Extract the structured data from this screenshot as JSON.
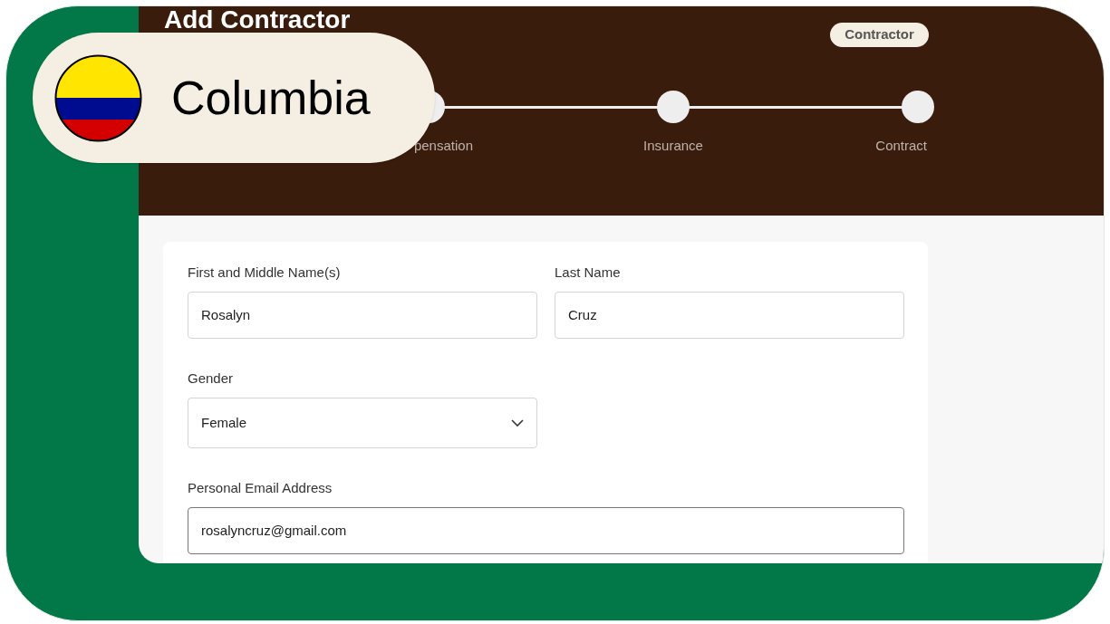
{
  "app": {
    "title": "Add Contractor",
    "badge": "Contractor"
  },
  "country_pill": {
    "label": "Columbia"
  },
  "stepper": {
    "steps": [
      {
        "label": "pensation"
      },
      {
        "label": "Insurance"
      },
      {
        "label": "Contract"
      }
    ]
  },
  "form": {
    "fields": [
      {
        "kind": "text",
        "label": "First and Middle Name(s)",
        "value": "Rosalyn",
        "focused": false
      },
      {
        "kind": "text",
        "label": "Last Name",
        "value": "Cruz",
        "focused": false
      },
      {
        "kind": "select",
        "label": "Gender",
        "value": "Female",
        "focused": false
      },
      {
        "kind": "email",
        "label": "Personal Email Address",
        "value": "rosalyncruz@gmail.com",
        "focused": true
      }
    ]
  }
}
